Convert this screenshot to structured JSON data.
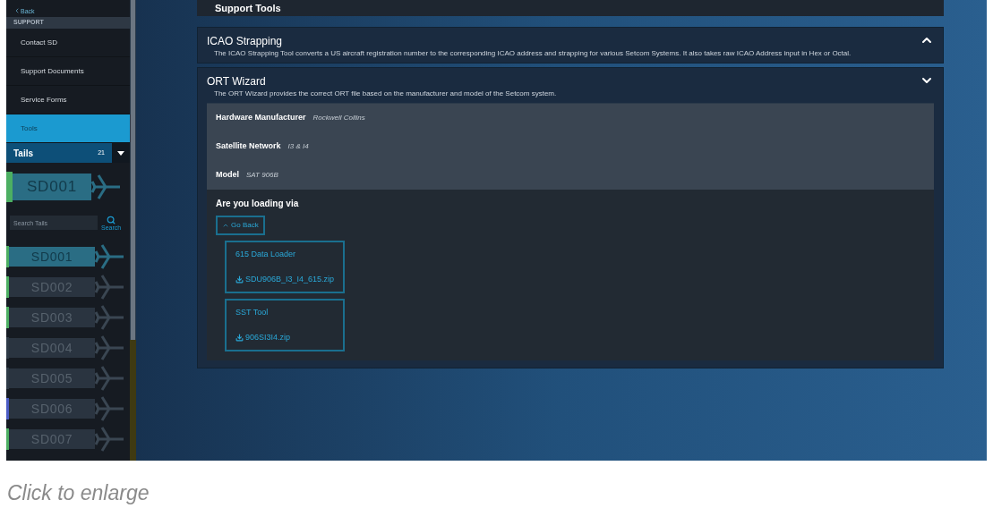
{
  "sidebar": {
    "back": "Back",
    "section": "SUPPORT",
    "items": [
      {
        "label": "Contact SD",
        "selected": false
      },
      {
        "label": "Support Documents",
        "selected": false
      },
      {
        "label": "Service Forms",
        "selected": false
      },
      {
        "label": "Tools",
        "selected": true
      }
    ],
    "tails": {
      "label": "Tails",
      "count": "21",
      "current": {
        "name": "SD001",
        "color": "#4caf62"
      },
      "search_placeholder": "Search Tails",
      "search_label": "Search",
      "list": [
        {
          "name": "SD001",
          "selected": true,
          "color": "#4caf62"
        },
        {
          "name": "SD002",
          "selected": false,
          "color": "#4caf62"
        },
        {
          "name": "SD003",
          "selected": false,
          "color": "#4caf62"
        },
        {
          "name": "SD004",
          "selected": false,
          "color": "#2e3a46"
        },
        {
          "name": "SD005",
          "selected": false,
          "color": "#2e3a46"
        },
        {
          "name": "SD006",
          "selected": false,
          "color": "#4a5bc4"
        },
        {
          "name": "SD007",
          "selected": false,
          "color": "#4caf62"
        }
      ]
    }
  },
  "page_title": "Support Tools",
  "tools": [
    {
      "title": "ICAO Strapping",
      "description": "The ICAO Strapping Tool converts a US aircraft registration number to the corresponding ICAO address and strapping for various Setcom Systems. It also takes raw ICAO Address input in Hex or Octal.",
      "expanded": false
    },
    {
      "title": "ORT Wizard",
      "description": "The ORT Wizard provides the correct ORT file based on the manufacturer and model of the Setcom system.",
      "expanded": true
    }
  ],
  "wizard": {
    "fields": [
      {
        "label": "Hardware Manufacturer",
        "value": "Rockwell Collins"
      },
      {
        "label": "Satellite Network",
        "value": "I3 & I4"
      },
      {
        "label": "Model",
        "value": "SAT 906B"
      }
    ],
    "question": "Are you loading via",
    "go_back": "Go Back",
    "options": [
      {
        "title": "615 Data Loader",
        "file": "SDU906B_I3_I4_615.zip"
      },
      {
        "title": "SST Tool",
        "file": "906SI3I4.zip"
      }
    ]
  },
  "caption": "Click to enlarge"
}
